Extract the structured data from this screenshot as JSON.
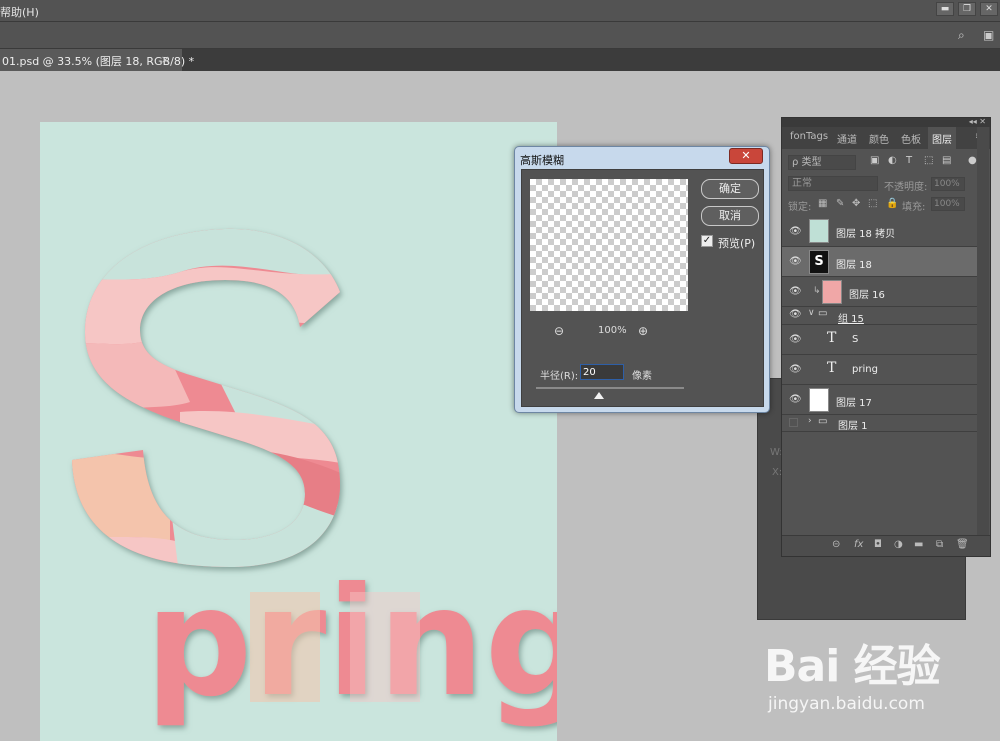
{
  "menubar": {
    "menu_text": "帮助(H)"
  },
  "window_controls": [
    "minimize",
    "restore",
    "close"
  ],
  "document_tab": {
    "label": "01.psd @ 33.5% (图层 18, RGB/8) *",
    "close": "×"
  },
  "canvas": {
    "background": "#cae5dd",
    "big_letter": "S",
    "word": "pring",
    "colors": [
      "#ee8a92",
      "#f6c6c5",
      "#f5c5a3",
      "#c8e3db",
      "#e77e86"
    ]
  },
  "gaussian_dialog": {
    "title": "高斯模糊",
    "close_label": "✕",
    "ok_label": "确定",
    "cancel_label": "取消",
    "preview_label": "预览(P)",
    "preview_checked": true,
    "zoom_out": "⊖",
    "zoom_in": "⊕",
    "zoom_value": "100%",
    "radius_label": "半径(R):",
    "radius_value": "20",
    "radius_unit": "像素"
  },
  "layers_panel": {
    "tabs": [
      "fonTags",
      "通道",
      "颜色",
      "色板",
      "图层"
    ],
    "active_tab": "图层",
    "filter_kind": "ρ 类型",
    "blend_mode": "正常",
    "opacity_label": "不透明度:",
    "opacity_value": "100%",
    "lock_label": "锁定:",
    "fill_label": "填充:",
    "fill_value": "100%",
    "layers": [
      {
        "name": "图层 18 拷贝",
        "type": "image",
        "selected": false
      },
      {
        "name": "图层 18",
        "type": "image",
        "selected": true
      },
      {
        "name": "图层 16",
        "type": "image",
        "selected": false
      },
      {
        "name": "组 15",
        "type": "group",
        "selected": false
      },
      {
        "name": "S",
        "type": "text",
        "selected": false
      },
      {
        "name": "pring",
        "type": "text",
        "selected": false
      },
      {
        "name": "图层 17",
        "type": "image",
        "selected": false
      },
      {
        "name": "图层 1",
        "type": "group",
        "selected": false
      }
    ],
    "footer_icons": [
      "link-icon",
      "fx-icon",
      "mask-icon",
      "adjustment-icon",
      "folder-icon",
      "new-layer-icon",
      "trash-icon"
    ]
  },
  "props_bg": {
    "w_label": "W:",
    "x_label": "X:"
  },
  "watermark": {
    "logo": "Bai 经验",
    "url": "jingyan.baidu.com"
  }
}
